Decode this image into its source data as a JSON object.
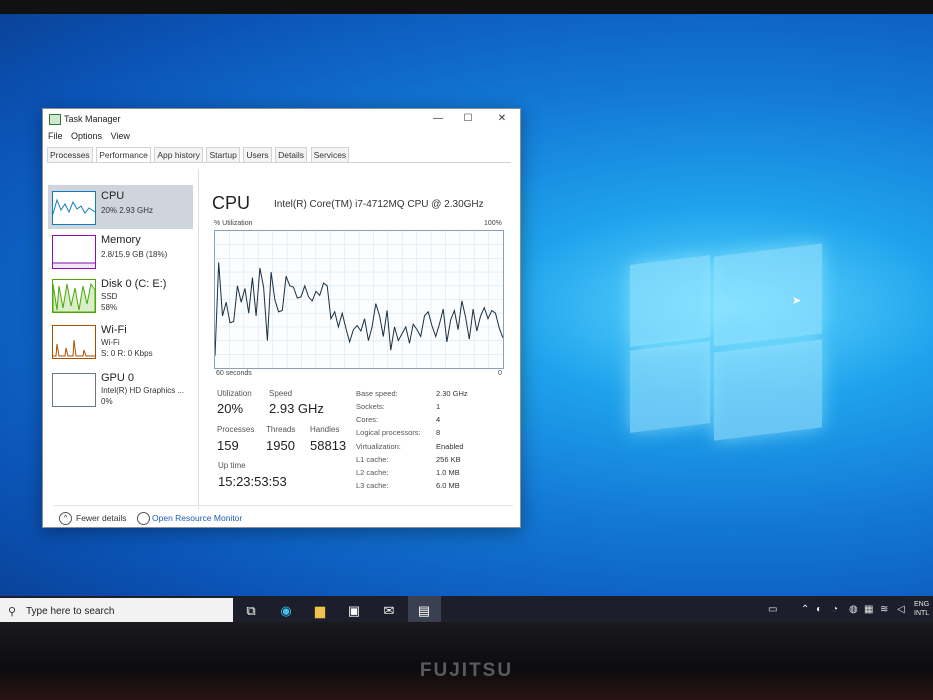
{
  "window": {
    "title": "Task Manager",
    "minimize_glyph": "—",
    "maximize_glyph": "☐",
    "close_glyph": "✕"
  },
  "menu": [
    "File",
    "Options",
    "View"
  ],
  "tabs": [
    "Processes",
    "Performance",
    "App history",
    "Startup",
    "Users",
    "Details",
    "Services"
  ],
  "active_tab": "Performance",
  "sidebar": {
    "items": [
      {
        "name": "CPU",
        "sub1": "20% 2.93 GHz",
        "sub2": "",
        "sub3": ""
      },
      {
        "name": "Memory",
        "sub1": "2.8/15.9 GB (18%)",
        "sub2": "",
        "sub3": ""
      },
      {
        "name": "Disk 0 (C: E:)",
        "sub1": "SSD",
        "sub2": "58%",
        "sub3": ""
      },
      {
        "name": "Wi-Fi",
        "sub1": "Wi-Fi",
        "sub2": "S: 0 R: 0 Kbps",
        "sub3": ""
      },
      {
        "name": "GPU 0",
        "sub1": "Intel(R) HD Graphics ...",
        "sub2": "0%",
        "sub3": ""
      }
    ]
  },
  "main": {
    "title": "CPU",
    "model": "Intel(R) Core(TM) i7-4712MQ CPU @ 2.30GHz",
    "util_label": "% Utilization",
    "max_label": "100%",
    "time_label": "60 seconds",
    "min_label": "0",
    "utilization_values": [
      0.09,
      0.77,
      0.38,
      0.48,
      0.33,
      0.34,
      0.6,
      0.48,
      0.58,
      0.4,
      0.66,
      0.38,
      0.73,
      0.59,
      0.2,
      0.7,
      0.5,
      0.41,
      0.42,
      0.67,
      0.6,
      0.59,
      0.51,
      0.52,
      0.6,
      0.52,
      0.49,
      0.56,
      0.53,
      0.62,
      0.6,
      0.36,
      0.41,
      0.3,
      0.4,
      0.29,
      0.19,
      0.28,
      0.31,
      0.27,
      0.36,
      0.2,
      0.3,
      0.47,
      0.38,
      0.23,
      0.42,
      0.13,
      0.3,
      0.2,
      0.25,
      0.3,
      0.18,
      0.32,
      0.28,
      0.23,
      0.38,
      0.41,
      0.31,
      0.23,
      0.32,
      0.43,
      0.19,
      0.35,
      0.42,
      0.28,
      0.49,
      0.37,
      0.21,
      0.43,
      0.27,
      0.38,
      0.44,
      0.36,
      0.42,
      0.4,
      0.29,
      0.22
    ],
    "stats": {
      "utilization_label": "Utilization",
      "utilization": "20%",
      "speed_label": "Speed",
      "speed": "2.93 GHz",
      "processes_label": "Processes",
      "processes": "159",
      "threads_label": "Threads",
      "threads": "1950",
      "handles_label": "Handles",
      "handles": "58813",
      "uptime_label": "Up time",
      "uptime": "15:23:53:53"
    },
    "specs": [
      {
        "k": "Base speed:",
        "v": "2.30 GHz"
      },
      {
        "k": "Sockets:",
        "v": "1"
      },
      {
        "k": "Cores:",
        "v": "4"
      },
      {
        "k": "Logical processors:",
        "v": "8"
      },
      {
        "k": "Virtualization:",
        "v": "Enabled"
      },
      {
        "k": "L1 cache:",
        "v": "256 KB"
      },
      {
        "k": "L2 cache:",
        "v": "1.0 MB"
      },
      {
        "k": "L3 cache:",
        "v": "6.0 MB"
      }
    ]
  },
  "footer": {
    "fewer_details": "Fewer details",
    "open_resource_monitor": "Open Resource Monitor"
  },
  "taskbar": {
    "search_placeholder": "Type here to search",
    "lang_top": "ENG",
    "lang_bottom": "INTL"
  },
  "brand": "FUJITSU",
  "colors": {
    "graph_line": "#1b2f3f",
    "cpu_accent": "#117dbb",
    "disk_accent": "#4da60c",
    "wifi_accent": "#a74f01"
  }
}
